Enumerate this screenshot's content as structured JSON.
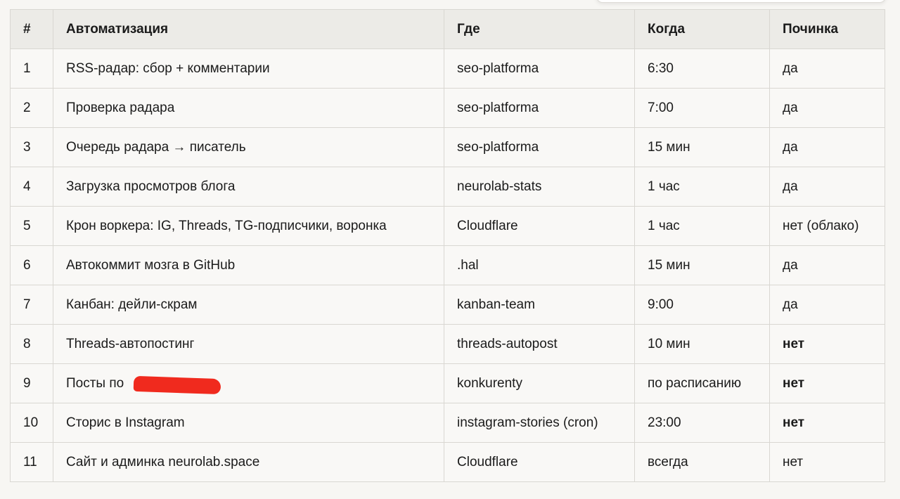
{
  "table": {
    "headers": {
      "num": "#",
      "name": "Автоматизация",
      "where": "Где",
      "when": "Когда",
      "fix": "Починка"
    },
    "rows": [
      {
        "num": "1",
        "name": "RSS-радар: сбор + комментарии",
        "where": "seo-platforma",
        "when": "6:30",
        "fix": "да",
        "fix_bold": false
      },
      {
        "num": "2",
        "name": "Проверка радара",
        "where": "seo-platforma",
        "when": "7:00",
        "fix": "да",
        "fix_bold": false
      },
      {
        "num": "3",
        "name": "Очередь радара → писатель",
        "where": "seo-platforma",
        "when": "15 мин",
        "fix": "да",
        "fix_bold": false
      },
      {
        "num": "4",
        "name": "Загрузка просмотров блога",
        "where": "neurolab-stats",
        "when": "1 час",
        "fix": "да",
        "fix_bold": false
      },
      {
        "num": "5",
        "name": "Крон воркера: IG, Threads, TG-подписчики, воронка",
        "where": "Cloudflare",
        "when": "1 час",
        "fix": "нет (облако)",
        "fix_bold": false
      },
      {
        "num": "6",
        "name": "Автокоммит мозга в GitHub",
        "where": ".hal",
        "when": "15 мин",
        "fix": "да",
        "fix_bold": false
      },
      {
        "num": "7",
        "name": "Канбан: дейли-скрам",
        "where": "kanban-team",
        "when": "9:00",
        "fix": "да",
        "fix_bold": false
      },
      {
        "num": "8",
        "name": "Threads-автопостинг",
        "where": "threads-autopost",
        "when": "10 мин",
        "fix": "нет",
        "fix_bold": true
      },
      {
        "num": "9",
        "name": "Посты по",
        "name_redacted": true,
        "where": "konkurenty",
        "when": "по расписанию",
        "fix": "нет",
        "fix_bold": true
      },
      {
        "num": "10",
        "name": "Сторис в Instagram",
        "where": "instagram-stories (cron)",
        "when": "23:00",
        "fix": "нет",
        "fix_bold": true
      },
      {
        "num": "11",
        "name": "Сайт и админка neurolab.space",
        "where": "Cloudflare",
        "when": "всегда",
        "fix": "нет",
        "fix_bold": false
      }
    ]
  }
}
